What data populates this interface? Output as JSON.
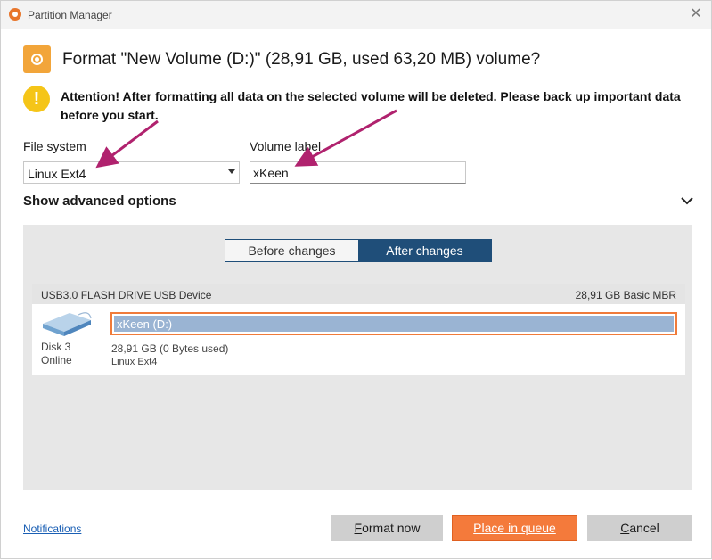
{
  "window": {
    "title": "Partition Manager",
    "close_glyph": "✕"
  },
  "header": {
    "title": "Format \"New Volume (D:)\" (28,91 GB, used 63,20 MB) volume?",
    "icon": "disk-format-icon"
  },
  "warning": {
    "icon": "exclamation-icon",
    "text": "Attention! After formatting all data on the selected volume will be deleted. Please back up important data before you start."
  },
  "file_system": {
    "label": "File system",
    "value": "Linux Ext4"
  },
  "volume_label": {
    "label": "Volume label",
    "value": "xKeen"
  },
  "advanced": {
    "label": "Show advanced options",
    "icon": "chevron-down-icon"
  },
  "preview": {
    "tabs": [
      {
        "label": "Before changes"
      },
      {
        "label": "After changes"
      }
    ],
    "selected_tab": "After changes",
    "disk": {
      "name": "USB3.0 FLASH DRIVE USB Device",
      "size_info": "28,91 GB Basic MBR",
      "number": "Disk 3",
      "status": "Online",
      "icon": "drive-icon"
    },
    "partition": {
      "label": "xKeen (D:)",
      "usage": "28,91 GB (0 Bytes used)",
      "file_system": "Linux Ext4"
    }
  },
  "footer": {
    "notifications": "Notifications",
    "format_now": {
      "first": "F",
      "rest": "ormat now"
    },
    "place_in_queue": {
      "first": "P",
      "rest": "lace in queue"
    },
    "cancel": {
      "first": "C",
      "rest": "ancel"
    }
  },
  "colors": {
    "accent": "#f47a3b",
    "tab_selected": "#1f4e79",
    "partition_fill": "#9ab4d3",
    "annotation_arrow": "#b0226e",
    "warning": "#f5c518"
  }
}
